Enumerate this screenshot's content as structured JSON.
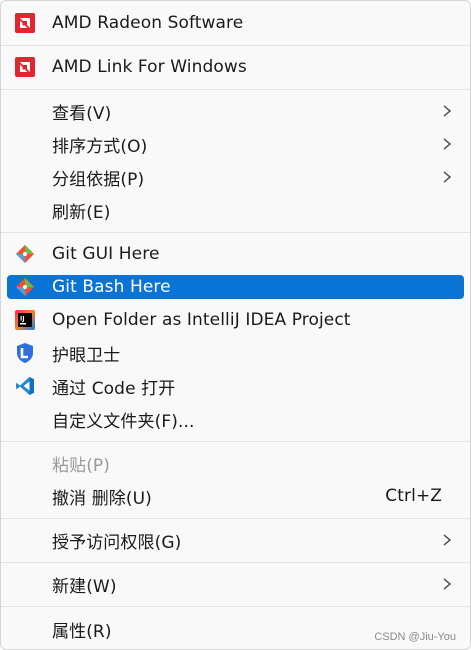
{
  "menu": {
    "items": [
      {
        "label": "AMD Radeon Software"
      },
      {
        "label": "AMD Link For Windows"
      },
      {
        "label": "查看(V)"
      },
      {
        "label": "排序方式(O)"
      },
      {
        "label": "分组依据(P)"
      },
      {
        "label": "刷新(E)"
      },
      {
        "label": "Git GUI Here"
      },
      {
        "label": "Git Bash Here"
      },
      {
        "label": "Open Folder as IntelliJ IDEA Project"
      },
      {
        "label": "护眼卫士"
      },
      {
        "label": "通过 Code 打开"
      },
      {
        "label": "自定义文件夹(F)..."
      },
      {
        "label": "粘贴(P)"
      },
      {
        "label": "撤消 删除(U)",
        "shortcut": "Ctrl+Z"
      },
      {
        "label": "授予访问权限(G)"
      },
      {
        "label": "新建(W)"
      },
      {
        "label": "属性(R)"
      }
    ]
  },
  "watermark": "CSDN @Jiu-You",
  "colors": {
    "highlight": "#0a74d6",
    "amd_red": "#e2262f",
    "git_orange": "#f05033",
    "vscode_blue": "#1f8ad2",
    "eye_blue": "#2e6fe0"
  }
}
